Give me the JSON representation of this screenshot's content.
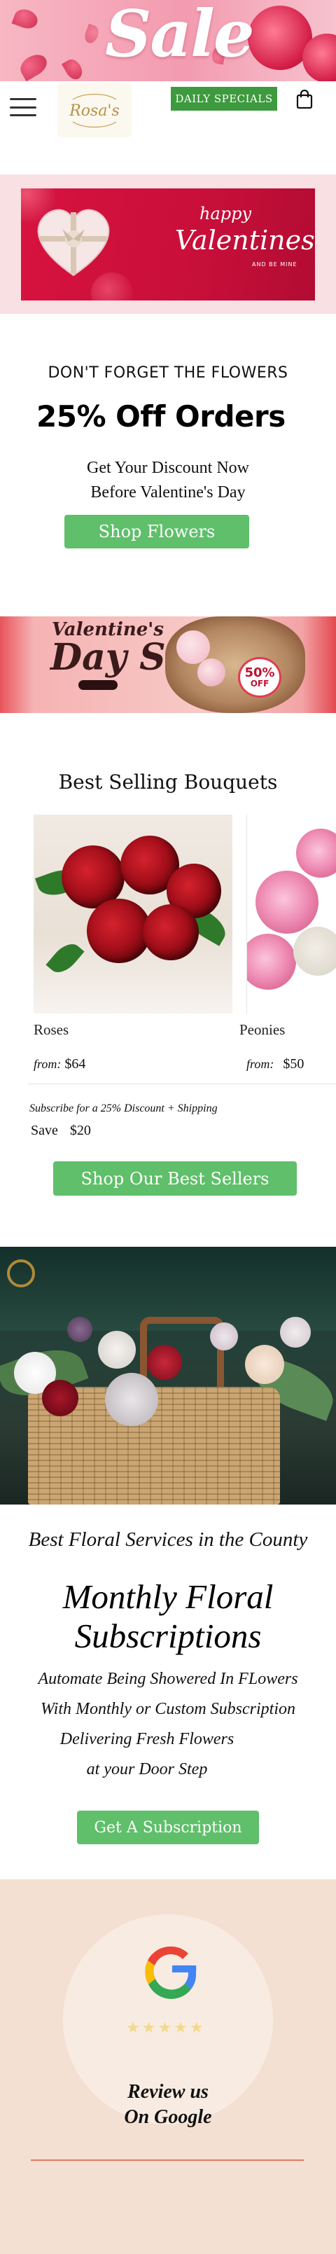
{
  "sale_banner": {
    "title": "Sale"
  },
  "header": {
    "logo_text": "Rosa's",
    "menu_icon": "hamburger-menu-icon",
    "specials_label": "DAILY SPECIALS",
    "cart_icon": "shopping-bag-icon"
  },
  "valentine_banner": {
    "happy": "happy",
    "valentines": "Valentines",
    "be_mine": "AND BE MINE"
  },
  "promo": {
    "eyebrow": "DON'T FORGET THE FLOWERS",
    "title": "25% Off Orders",
    "line1": "Get Your  Discount Now",
    "line2": "Before Valentine's Day",
    "button": "Shop Flowers"
  },
  "sale_banner_2": {
    "title_line1": "Valentine's",
    "title_line2": "Day Sale",
    "badge_number": "50%",
    "badge_off": "OFF"
  },
  "best_selling": {
    "heading": "Best Selling Bouquets",
    "products": [
      {
        "name": "Roses",
        "price_prefix": "from:",
        "price": "$64"
      },
      {
        "name": "Peonies",
        "price_prefix": "from:",
        "price": "$50"
      }
    ],
    "subscribe_note": "Subscribe for a 25% Discount + Shipping",
    "save_label": "Save",
    "save_amount": "$20",
    "button": "Shop Our Best Sellers"
  },
  "subscriptions": {
    "services_title": "Best Floral Services in the County",
    "title_line1": "Monthly Floral",
    "title_line2": "Subscriptions",
    "line1": "Automate Being Showered In FLowers",
    "line2": "With Monthly or Custom Subscription",
    "line3": "Delivering  Fresh Flowers",
    "line4": "at your Door Step",
    "button": "Get A Subscription"
  },
  "review": {
    "stars": "★★★★★",
    "line1": "Review us",
    "line2": "On Google"
  },
  "colors": {
    "accent_green": "#5fbf6a",
    "specials_green": "#3d9a3e",
    "valentine_red": "#d7133e",
    "review_bg": "#f4e0d2",
    "divider_red": "#e07a5f"
  }
}
